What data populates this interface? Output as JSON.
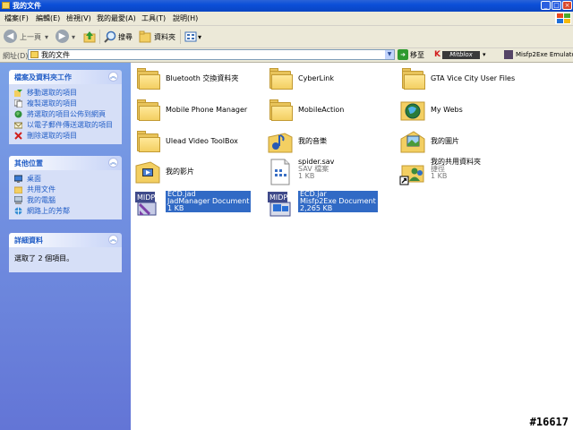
{
  "window": {
    "title": "我的文件"
  },
  "menu": [
    "檔案(F)",
    "編輯(E)",
    "檢視(V)",
    "我的最愛(A)",
    "工具(T)",
    "說明(H)"
  ],
  "toolbar": {
    "back": "上一頁",
    "search": "搜尋",
    "folders": "資料夾"
  },
  "address": {
    "label": "網址(D)",
    "value": "我的文件",
    "go": "移至",
    "kbrand_k": "K",
    "kbrand": "Mitblox",
    "extension": "Misfp2Exe Emulator"
  },
  "tasks": {
    "title": "檔案及資料夾工作",
    "items": [
      {
        "label": "移動選取的項目",
        "icon": "move-icon"
      },
      {
        "label": "複製選取的項目",
        "icon": "copy-icon"
      },
      {
        "label": "將選取的項目公佈到網頁",
        "icon": "publish-web-icon"
      },
      {
        "label": "以電子郵件傳送選取的項目",
        "icon": "email-icon"
      },
      {
        "label": "刪除選取的項目",
        "icon": "delete-icon"
      }
    ]
  },
  "places": {
    "title": "其他位置",
    "items": [
      {
        "label": "桌面",
        "icon": "desktop-icon"
      },
      {
        "label": "共用文件",
        "icon": "shared-folder-icon"
      },
      {
        "label": "我的電腦",
        "icon": "my-computer-icon"
      },
      {
        "label": "網路上的芳鄰",
        "icon": "network-icon"
      }
    ]
  },
  "details": {
    "title": "詳細資料",
    "text": "選取了 2 個項目。"
  },
  "files": [
    {
      "name": "Bluetooth 交換資料夾",
      "icon": "folder-icon"
    },
    {
      "name": "CyberLink",
      "icon": "folder-icon"
    },
    {
      "name": "GTA Vice City User Files",
      "icon": "folder-icon"
    },
    {
      "name": "Mobile Phone Manager",
      "icon": "folder-icon"
    },
    {
      "name": "MobileAction",
      "icon": "folder-icon"
    },
    {
      "name": "My Webs",
      "icon": "web-folder-icon"
    },
    {
      "name": "Ulead Video ToolBox",
      "icon": "folder-icon"
    },
    {
      "name": "我的音樂",
      "icon": "music-folder-icon"
    },
    {
      "name": "我的圖片",
      "icon": "pictures-folder-icon"
    },
    {
      "name": "我的影片",
      "icon": "video-folder-icon"
    },
    {
      "name": "spider.sav",
      "type": "SAV 檔案",
      "size": "1 KB",
      "icon": "sav-file-icon"
    },
    {
      "name": "我的共用資料夾",
      "type": "捷徑",
      "size": "1 KB",
      "icon": "shared-shortcut-icon"
    },
    {
      "name": "ECD.jad",
      "type": "JadManager Document",
      "size": "1 KB",
      "icon": "jad-file-icon",
      "selected": true
    },
    {
      "name": "ECD.jar",
      "type": "Misfp2Exe Document",
      "size": "2,265 KB",
      "icon": "jar-file-icon",
      "selected": true
    }
  ],
  "watermark": "#16617"
}
